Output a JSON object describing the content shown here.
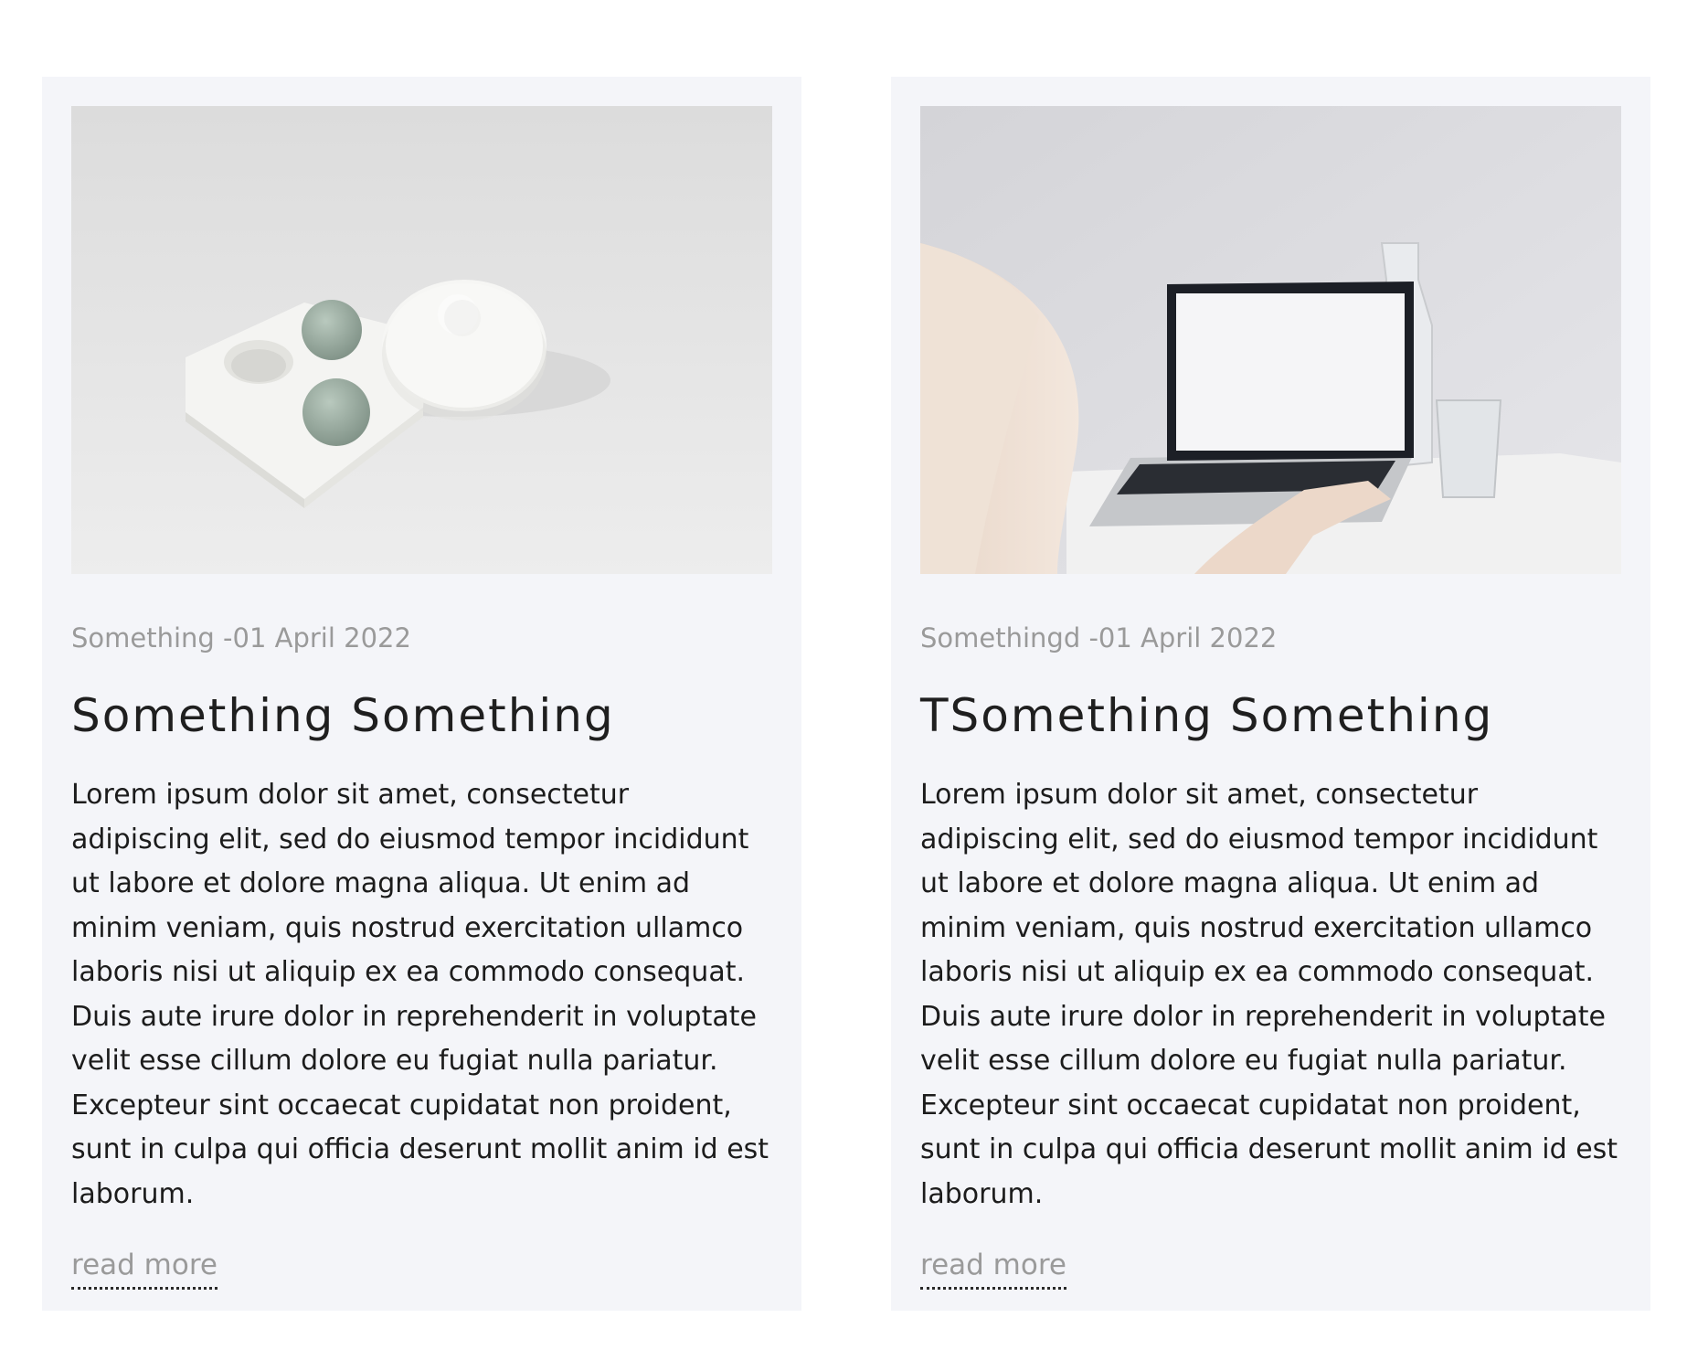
{
  "posts": [
    {
      "image_alt": "white concrete tray with green spheres",
      "meta": "Something -01 April 2022",
      "title": "Something Something",
      "excerpt": "Lorem ipsum dolor sit amet, consectetur adipiscing elit, sed do eiusmod tempor incididunt ut labore et dolore magna aliqua. Ut enim ad minim veniam, quis nostrud exercitation ullamco laboris nisi ut aliquip ex ea commodo consequat. Duis aute irure dolor in reprehenderit in voluptate velit esse cillum dolore eu fugiat nulla pariatur. Excepteur sint occaecat cupidatat non proident, sunt in culpa qui officia deserunt mollit anim id est laborum.",
      "read_more": "read more"
    },
    {
      "image_alt": "person typing on laptop beside glass carafe",
      "meta": "Somethingd -01 April 2022",
      "title": "TSomething Something",
      "excerpt": "Lorem ipsum dolor sit amet, consectetur adipiscing elit, sed do eiusmod tempor incididunt ut labore et dolore magna aliqua. Ut enim ad minim veniam, quis nostrud exercitation ullamco laboris nisi ut aliquip ex ea commodo consequat. Duis aute irure dolor in reprehenderit in voluptate velit esse cillum dolore eu fugiat nulla pariatur. Excepteur sint occaecat cupidatat non proident, sunt in culpa qui officia deserunt mollit anim id est laborum.",
      "read_more": "read more"
    }
  ],
  "colors": {
    "card_background": "#f4f5f9",
    "meta_text": "#9a9a9a",
    "title_text": "#1f1f1f",
    "body_text": "#1c1c1c"
  }
}
